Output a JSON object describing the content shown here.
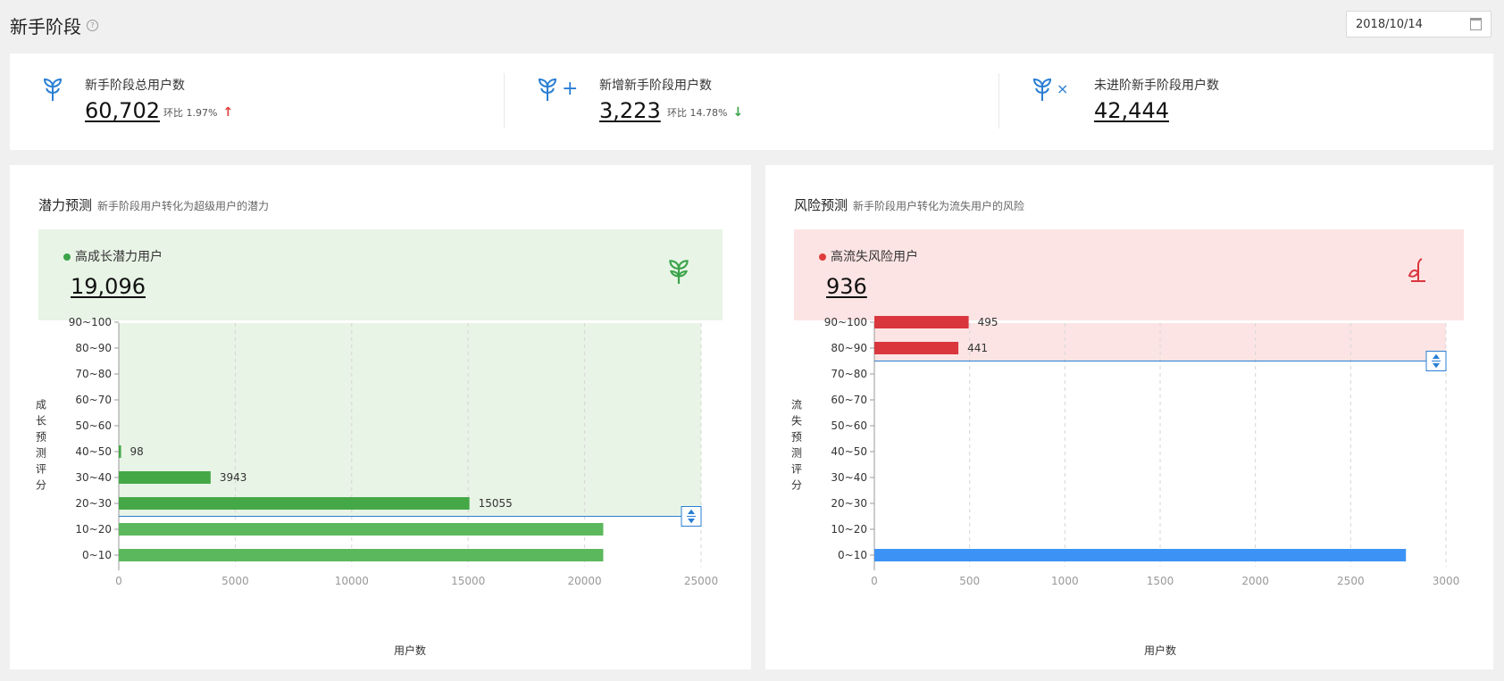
{
  "header": {
    "title": "新手阶段",
    "help_icon": "question-circle-icon",
    "date": "2018/10/14",
    "date_icon": "calendar-icon"
  },
  "stats": [
    {
      "label": "新手阶段总用户数",
      "value": "60,702",
      "ratio_label": "环比",
      "ratio": "1.97%",
      "trend": "up",
      "icon": "sprout-icon",
      "color": "#e03c3c"
    },
    {
      "label": "新增新手阶段用户数",
      "value": "3,223",
      "ratio_label": "环比",
      "ratio": "14.78%",
      "trend": "down",
      "icon": "sprout-plus-icon",
      "color": "#3aa34a"
    },
    {
      "label": "未进阶新手阶段用户数",
      "value": "42,444",
      "icon": "sprout-x-icon"
    }
  ],
  "arrows": {
    "up": "↑",
    "down": "↓",
    "plus": "+",
    "times": "×"
  },
  "colors": {
    "accent": "#2a7fd4",
    "green": "#3aa34a",
    "red": "#d9363e",
    "blue": "#3d93f5",
    "green_bg": "#e8f4e6",
    "red_bg": "#fde4e4"
  },
  "potential": {
    "title": "潜力预测",
    "subtitle": "新手阶段用户转化为超级用户的潜力",
    "hero_label": "高成长潜力用户",
    "hero_value": "19,096",
    "hero_icon": "sprout-icon"
  },
  "risk": {
    "title": "风险预测",
    "subtitle": "新手阶段用户转化为流失用户的风险",
    "hero_label": "高流失风险用户",
    "hero_value": "936",
    "hero_icon": "wilted-sprout-icon"
  },
  "chart_data": [
    {
      "type": "bar",
      "orientation": "horizontal",
      "categories": [
        "0~10",
        "10~20",
        "20~30",
        "30~40",
        "40~50",
        "50~60",
        "60~70",
        "70~80",
        "80~90",
        "90~100"
      ],
      "values": [
        20800,
        20800,
        15055,
        3943,
        98,
        0,
        0,
        0,
        0,
        0
      ],
      "data_labels": [
        "",
        "",
        "15055",
        "3943",
        "98",
        "",
        "",
        "",
        "",
        ""
      ],
      "xlabel": "用户数",
      "ylabel": "成长预测评分",
      "xlim": [
        0,
        25000
      ],
      "xticks": [
        0,
        5000,
        10000,
        15000,
        20000,
        25000
      ],
      "threshold_between": [
        "10~20",
        "20~30"
      ],
      "highlight": "above-threshold",
      "grid": "vertical-dashed"
    },
    {
      "type": "bar",
      "orientation": "horizontal",
      "categories": [
        "0~10",
        "10~20",
        "20~30",
        "30~40",
        "40~50",
        "50~60",
        "60~70",
        "70~80",
        "80~90",
        "90~100"
      ],
      "values": [
        2790,
        0,
        0,
        0,
        0,
        0,
        0,
        0,
        441,
        495
      ],
      "data_labels": [
        "",
        "",
        "",
        "",
        "",
        "",
        "",
        "",
        "441",
        "495"
      ],
      "xlabel": "用户数",
      "ylabel": "流失预测评分",
      "xlim": [
        0,
        3000
      ],
      "xticks": [
        0,
        500,
        1000,
        1500,
        2000,
        2500,
        3000
      ],
      "threshold_between": [
        "70~80",
        "80~90"
      ],
      "highlight": "above-threshold",
      "grid": "vertical-dashed"
    }
  ]
}
